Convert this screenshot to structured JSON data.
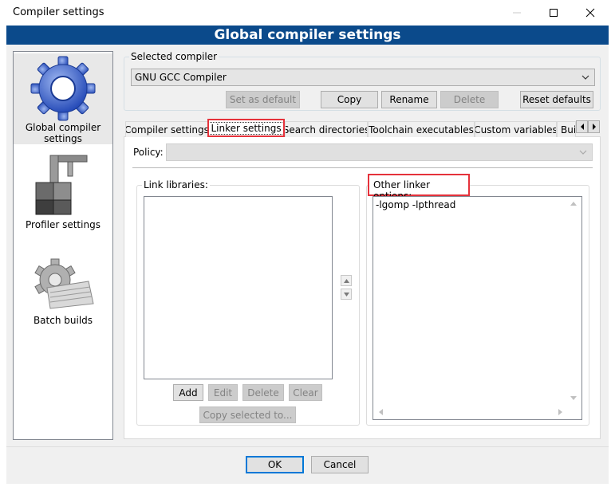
{
  "window": {
    "title": "Compiler settings",
    "header": "Global compiler settings"
  },
  "sidebar": {
    "items": [
      {
        "label": "Global compiler settings",
        "icon": "gear-icon"
      },
      {
        "label": "Profiler settings",
        "icon": "caliper-icon"
      },
      {
        "label": "Batch builds",
        "icon": "gear-stack-icon"
      }
    ]
  },
  "compiler": {
    "legend": "Selected compiler",
    "selected": "GNU GCC Compiler",
    "buttons": {
      "set_default": "Set as default",
      "copy": "Copy",
      "rename": "Rename",
      "delete": "Delete",
      "reset": "Reset defaults"
    }
  },
  "tabs": [
    "Compiler settings",
    "Linker settings",
    "Search directories",
    "Toolchain executables",
    "Custom variables",
    "Bui"
  ],
  "linker": {
    "policy_label": "Policy:",
    "policy_value": "",
    "link_libraries_legend": "Link libraries:",
    "other_options_legend": "Other linker options:",
    "other_options_value": "-lgomp -lpthread",
    "buttons": {
      "add": "Add",
      "edit": "Edit",
      "delete": "Delete",
      "clear": "Clear",
      "copy_selected": "Copy selected to..."
    }
  },
  "footer": {
    "ok": "OK",
    "cancel": "Cancel"
  }
}
